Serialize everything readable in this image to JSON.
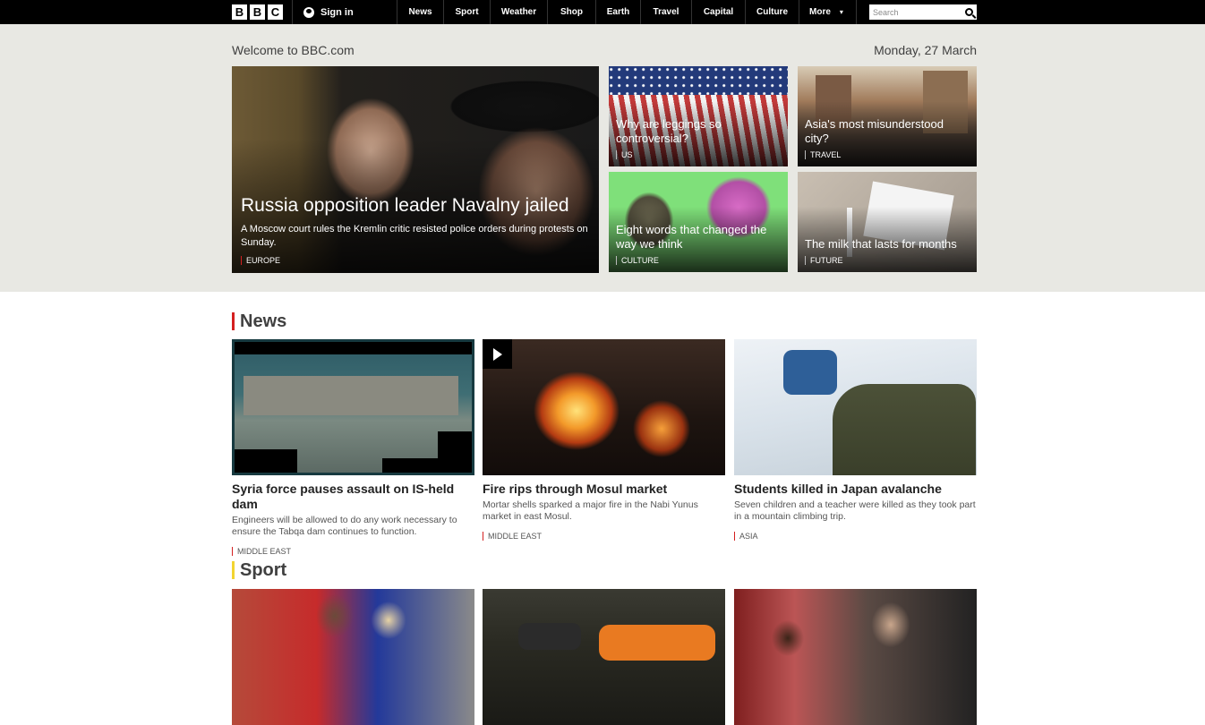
{
  "header": {
    "logo_letters": [
      "B",
      "B",
      "C"
    ],
    "signin_label": "Sign in",
    "nav": [
      "News",
      "Sport",
      "Weather",
      "Shop",
      "Earth",
      "Travel",
      "Capital",
      "Culture"
    ],
    "more_label": "More",
    "search_placeholder": "Search"
  },
  "hero": {
    "welcome": "Welcome to BBC.com",
    "date": "Monday, 27 March",
    "main": {
      "title": "Russia opposition leader Navalny jailed",
      "summary": "A Moscow court rules the Kremlin critic resisted police orders during protests on Sunday.",
      "tag": "EUROPE"
    },
    "cards": [
      {
        "title": "Why are leggings so controversial?",
        "tag": "US"
      },
      {
        "title": "Asia's most misunderstood city?",
        "tag": "TRAVEL"
      },
      {
        "title": "Eight words that changed the way we think",
        "tag": "CULTURE"
      },
      {
        "title": "The milk that lasts for months",
        "tag": "FUTURE"
      }
    ]
  },
  "news": {
    "heading": "News",
    "accent": "#d42020",
    "stories": [
      {
        "headline": "Syria force pauses assault on IS-held dam",
        "summary": "Engineers will be allowed to do any work necessary to ensure the Tabqa dam continues to function.",
        "tag": "MIDDLE EAST"
      },
      {
        "headline": "Fire rips through Mosul market",
        "summary": "Mortar shells sparked a major fire in the Nabi Yunus market in east Mosul.",
        "tag": "MIDDLE EAST"
      },
      {
        "headline": "Students killed in Japan avalanche",
        "summary": "Seven children and a teacher were killed as they took part in a mountain climbing trip.",
        "tag": "ASIA"
      }
    ]
  },
  "sport": {
    "heading": "Sport",
    "accent": "#f2d431"
  }
}
